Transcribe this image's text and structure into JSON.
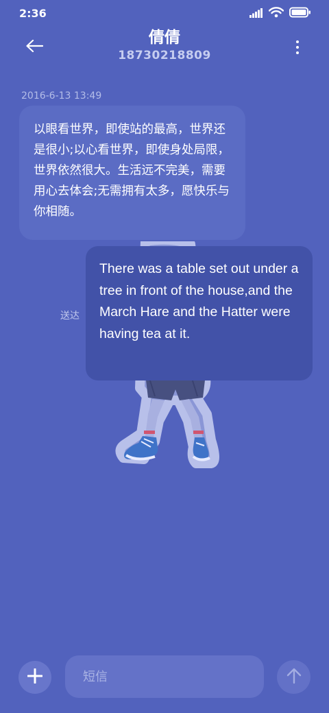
{
  "status_bar": {
    "time": "2:36",
    "icons": [
      "signal-icon",
      "wifi-icon",
      "battery-icon"
    ],
    "battery_level": 1.0
  },
  "header": {
    "back_icon": "arrow-left-icon",
    "contact_name": "倩倩",
    "contact_number": "18730218809",
    "more_icon": "more-vertical-icon"
  },
  "conversation": {
    "timestamp": "2016-6-13 13:49",
    "incoming_message": "以眼看世界，即使站的最高，世界还是很小;以心看世界，即使身处局限，世界依然很大。生活远不完美，需要用心去体会;无需拥有太多，愿快乐与你相随。",
    "sticker": "anime-character-sticker",
    "sent_status": "送达",
    "outgoing_message": "There was a table set out under a tree in front of the house,and the March Hare and the Hatter were having tea at it."
  },
  "composer": {
    "add_icon": "plus-icon",
    "placeholder": "短信",
    "value": "",
    "send_icon": "arrow-up-icon"
  },
  "colors": {
    "background": "#5262bd",
    "incoming_bubble": "#5b6cc4",
    "outgoing_bubble": "#4252a8",
    "input_background": "#6472c8",
    "muted_text": "#b4bde8"
  }
}
